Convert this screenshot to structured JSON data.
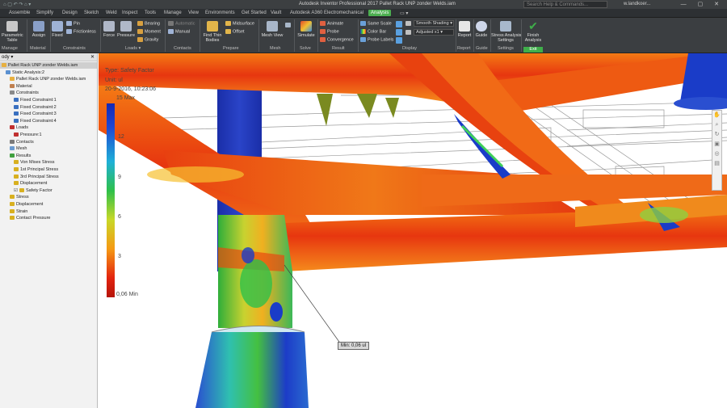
{
  "app": {
    "title": "Autodesk Inventor Professional 2017   Pallet Rack UNP zonder Welds.iam",
    "quick_access": "⌂ ▢ ↶ ↷ ⌂ ▾",
    "search_placeholder": "Search Help & Commands...",
    "user": "w.landkoer...",
    "window_controls": "— ▢ ✕"
  },
  "tabs": [
    "Assemble",
    "Simplify",
    "Design",
    "Sketch",
    "Weld",
    "Inspect",
    "Tools",
    "Manage",
    "View",
    "Environments",
    "Get Started",
    "Vault",
    "Autodesk A360",
    "Electromechanical",
    "Analysis",
    "▭ ▾"
  ],
  "active_tab": "Analysis",
  "ribbon": {
    "manage_group": "Manage",
    "parametric_table": "Parametric\nTable",
    "material_group": "Material",
    "assign": "Assign",
    "constraints_group": "Constraints",
    "fixed": "Fixed",
    "pin": "Pin",
    "frictionless": "Frictionless",
    "loads_group": "Loads ▾",
    "force": "Force",
    "pressure": "Pressure",
    "bearing": "Bearing",
    "moment": "Moment",
    "gravity": "Gravity",
    "contacts_group": "Contacts",
    "automatic": "Automatic",
    "manual": "Manual",
    "prepare_group": "Prepare",
    "find_thin_bodies": "Find Thin\nBodies",
    "midsurface": "Midsurface",
    "offset": "Offset",
    "mesh_group": "Mesh",
    "mesh_view": "Mesh View",
    "solve_group": "Solve",
    "simulate": "Simulate",
    "result_group": "Result",
    "animate": "Animate",
    "probe": "Probe",
    "convergence": "Convergence",
    "display_group": "Display",
    "same_scale": "Same Scale",
    "color_bar": "Color Bar",
    "probe_labels": "Probe Labels",
    "smooth_shading": "Smooth Shading ▾",
    "adjusted": "Adjusted x1 ▾",
    "report_group": "Report",
    "report": "Report",
    "guide_group": "Guide",
    "guide": "Guide",
    "settings_group": "Settings",
    "stress_analysis_settings": "Stress Analysis\nSettings",
    "exit_group": "Exit",
    "finish_analysis": "Finish\nAnalysis"
  },
  "browser": {
    "header": "ody ▾",
    "close": "✕",
    "items": [
      {
        "label": "Pallet Rack UNP zonder Welds.iam",
        "sel": true,
        "indent": 0
      },
      {
        "label": "Static Analysis:2",
        "indent": 1
      },
      {
        "label": "Pallet Rack UNP zonder Welds.iam",
        "indent": 2
      },
      {
        "label": "Material",
        "indent": 2
      },
      {
        "label": "Constraints",
        "indent": 2
      },
      {
        "label": "Fixed Constraint:1",
        "indent": 3
      },
      {
        "label": "Fixed Constraint:2",
        "indent": 3
      },
      {
        "label": "Fixed Constraint:3",
        "indent": 3
      },
      {
        "label": "Fixed Constraint:4",
        "indent": 3
      },
      {
        "label": "Loads",
        "indent": 2
      },
      {
        "label": "Pressure:1",
        "indent": 3
      },
      {
        "label": "Contacts",
        "indent": 2
      },
      {
        "label": "Mesh",
        "indent": 2
      },
      {
        "label": "Results",
        "indent": 2
      },
      {
        "label": "Von Mises Stress",
        "indent": 3
      },
      {
        "label": "1st Principal Stress",
        "indent": 3
      },
      {
        "label": "3rd Principal Stress",
        "indent": 3
      },
      {
        "label": "Displacement",
        "indent": 3
      },
      {
        "label": "Safety Factor",
        "indent": 3,
        "checked": true
      },
      {
        "label": "Stress",
        "indent": 2
      },
      {
        "label": "Displacement",
        "indent": 2
      },
      {
        "label": "Strain",
        "indent": 2
      },
      {
        "label": "Contact Pressure",
        "indent": 2
      }
    ]
  },
  "legend": {
    "type_line": "Type: Safety Factor",
    "unit_line": "Unit: ul",
    "date_line": "20-9-2016, 10:23:06",
    "max_label": "15 Max",
    "tick_12": "12",
    "tick_9": "9",
    "tick_6": "6",
    "tick_3": "3",
    "min_label": "0,06 Min"
  },
  "probe_label": "Min: 0,06 ul",
  "nav_icons": "✋ ⌕ ↻ ▣ ◎ ▤",
  "colors": {
    "ribbon_bg": "#3b3e41",
    "active_tab": "#4caf50",
    "finish_green": "#3fae4a",
    "stress_red": "#e3240f",
    "stress_orange": "#f57a14",
    "low_blue": "#1428b4"
  }
}
